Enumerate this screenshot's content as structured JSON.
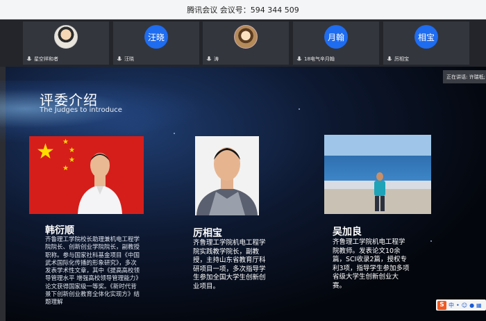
{
  "window": {
    "title": "腾讯会议 会议号：594 344 509"
  },
  "participants": [
    {
      "name": "星空祥和者",
      "avatar": "photo-avatar",
      "avatar_text": ""
    },
    {
      "name": "汪晓",
      "avatar": "initial",
      "avatar_text": "汪晓"
    },
    {
      "name": "涛",
      "avatar": "photo-avatar",
      "avatar_text": ""
    },
    {
      "name": "18电气辛月翰",
      "avatar": "initial",
      "avatar_text": "月翰"
    },
    {
      "name": "厉相宝",
      "avatar": "initial",
      "avatar_text": "相宝"
    }
  ],
  "speaking_indicator": "正在讲话: 许瑞柢;",
  "slide": {
    "title": "评委介绍",
    "subtitle": "The Judges to introduce",
    "judges": [
      {
        "name": "韩衍顺",
        "photo": "portrait-with-flag",
        "bio": "齐鲁理工学院校长助理兼机电工程学院院长、创新创业学院院长，副教授职称。参与国家社科基金项目《中国武术国际化传播的形象研究》，多次发表学术性文章，其中《提高高校领导管理水平 增强高校领导管理能力》论文获得国家级一等奖。《新时代背景下创新创业教育全体化实现方》结题理解"
      },
      {
        "name": "厉相宝",
        "photo": "id-portrait",
        "bio": "齐鲁理工学院机电工程学院实践教学院长，副教授，主持山东省教育厅科研项目一项，多次指导学生参加全国大学生创新创业项目。"
      },
      {
        "name": "吴加良",
        "photo": "outdoor-portrait",
        "bio": "齐鲁理工学院机电工程学院教师。发表论文10余篇，SCI收录2篇，授权专利3项，指导学生参加多项省级大学生创新创业大赛。"
      }
    ]
  },
  "taskbar": {
    "ime_logo": "S",
    "ime_mode": "中"
  },
  "colors": {
    "avatar_blue": "#1e6cf0",
    "flag_red": "#d51e1a",
    "ime_orange": "#f05a23"
  }
}
